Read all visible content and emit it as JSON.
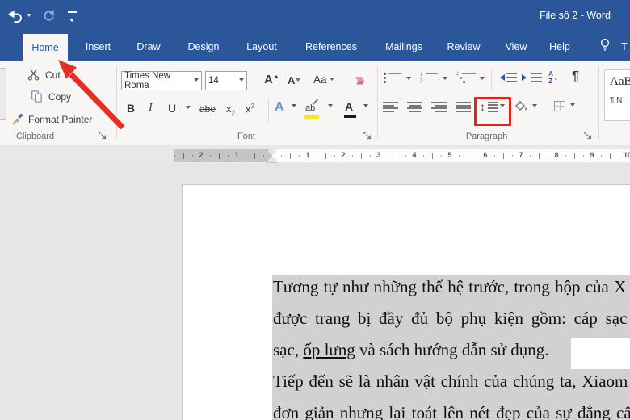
{
  "window": {
    "title": "File số 2  -  Word"
  },
  "tabs": {
    "active": "Home",
    "items": [
      "Home",
      "Insert",
      "Draw",
      "Design",
      "Layout",
      "References",
      "Mailings",
      "Review",
      "View",
      "Help"
    ],
    "tell_me_partial": "T"
  },
  "ribbon": {
    "clipboard": {
      "label": "Clipboard",
      "cut": "Cut",
      "copy": "Copy",
      "format_painter": "Format Painter"
    },
    "font": {
      "label": "Font",
      "family": "Times New Roma",
      "size": "14",
      "bold": "B",
      "italic": "I",
      "underline": "U",
      "strikethrough": "abe",
      "subscript_base": "x",
      "subscript_mark": "2",
      "superscript_base": "x",
      "superscript_mark": "2",
      "grow_font": "A",
      "shrink_font": "A",
      "change_case": "Aa",
      "text_effects": "A",
      "highlight": "ab",
      "font_color": "A"
    },
    "paragraph": {
      "label": "Paragraph",
      "sort_a": "A",
      "sort_z": "Z",
      "sort_arrow": "↓",
      "pilcrow": "¶",
      "line_spacing_arrow": "↕"
    },
    "styles": {
      "preview_large": "AaB",
      "preview_small": "¶ N"
    }
  },
  "ruler": {
    "left": [
      "2",
      "1"
    ],
    "right": [
      "1",
      "2",
      "3",
      "4",
      "5",
      "6",
      "7",
      "8",
      "9",
      "10"
    ]
  },
  "document": {
    "lines": [
      {
        "text": "Tương tự như những thế hệ trước, trong hộp của X"
      },
      {
        "text": "được trang bị đầy đủ bộ phụ kiện gồm: cáp sạc U"
      },
      {
        "pre": "sạc, ",
        "underlined": "ốp lưng",
        "post": " và sách hướng dẫn sử dụng."
      },
      {
        "text": "Tiếp đến sẽ là nhân vật chính của chúng ta, Xiaom"
      },
      {
        "text": "đơn giản nhưng lại toát lên nét đẹp của sự đẳng cấ"
      }
    ]
  },
  "colors": {
    "accent_blue": "#2b579a",
    "annotation_red": "#e1251b",
    "selection_gray": "#d2d1d0",
    "highlight_yellow": "#f8ec00"
  }
}
